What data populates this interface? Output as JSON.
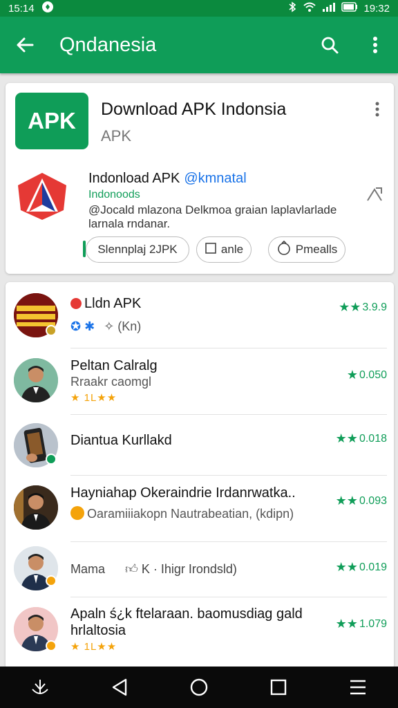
{
  "status": {
    "time": "15:14",
    "right_time": "19:32"
  },
  "appbar": {
    "title": "Qndanesia"
  },
  "header_card": {
    "logo_text": "APK",
    "title": "Download APK Indonsia",
    "subtitle": "APK",
    "featured": {
      "name": "Indonload APK",
      "handle": "@kmnatal",
      "tagline": "Indonoods",
      "description": "@Jocald mlazona Delkmoa graian laplavlarlade larnala rndanar.",
      "buttons": [
        "Slennplaj 2JPK",
        "anle",
        "Pmealls"
      ]
    }
  },
  "list": [
    {
      "name": "Lldn APK",
      "sub": "(Kn)",
      "rating": "3.9.9",
      "stars": ""
    },
    {
      "name": "Peltan Calralg",
      "sub": "Rraakr caomgl",
      "rating": "0.050",
      "stars": "★ 1L★★"
    },
    {
      "name": "Diantua Kurllakd",
      "sub": "",
      "rating": "0.018",
      "stars": ""
    },
    {
      "name": "Hayniahap  Okeraindrie Irdanrwatka..",
      "sub": "Oaramiiiakopn Nautrabeatian,  (kdipn)",
      "rating": "0.093",
      "stars": ""
    },
    {
      "name": "Mama",
      "sub": "K  ·  Ihigr Irondsld)",
      "rating": "0.019",
      "stars": ""
    },
    {
      "name": "Apaln ś¿k ftelaraan. baomusdiag  gald hrlaltosia",
      "sub": "",
      "rating": "1.079",
      "stars": "★ 1L★★"
    }
  ],
  "colors": {
    "primary": "#0f9d58",
    "status": "#0b8a3e",
    "accent": "#1a73e8",
    "star": "#f4a30b"
  }
}
